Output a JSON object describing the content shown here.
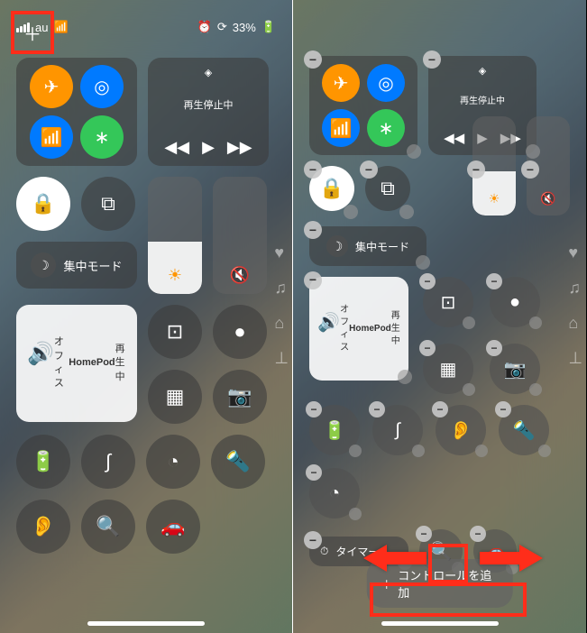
{
  "status": {
    "carrier": "au",
    "battery": "33%",
    "alarm": "⏰"
  },
  "media": {
    "status": "再生停止中"
  },
  "focus": {
    "label": "集中モード"
  },
  "home": {
    "room": "オフィス",
    "device": "HomePod",
    "status": "再生中"
  },
  "timer": {
    "label": "タイマー"
  },
  "addControl": {
    "label": "コントロールを追加",
    "icon": "＋"
  },
  "icons": {
    "airplane": "✈",
    "airdrop": "◎",
    "wifi": "📶",
    "bluetooth": "∗",
    "cellular": "📡",
    "hotspot": "⊕",
    "lock": "🔒",
    "copy": "⧉",
    "moon": "☽",
    "brightness": "☀",
    "mute": "🔇",
    "qr": "⊡",
    "record": "●",
    "calc": "▦",
    "camera": "📷",
    "battery": "🔋",
    "shazam": "∫",
    "stopwatch": "◔",
    "flashlight": "🔦",
    "hearing": "👂",
    "magnify": "🔍",
    "car": "🚗",
    "rewind": "◀◀",
    "play": "▶",
    "forward": "▶▶",
    "airplay": "◈",
    "heart": "♥",
    "music": "♫",
    "homekit": "⌂",
    "antenna": "⊥"
  }
}
